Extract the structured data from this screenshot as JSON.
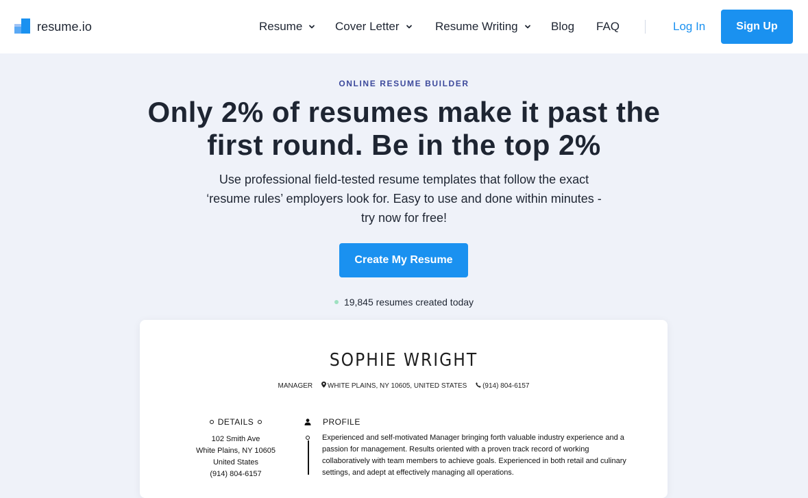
{
  "brand": {
    "name": "resume.io",
    "logo_icon": "resume-io-logo"
  },
  "nav": {
    "items": [
      {
        "label": "Resume",
        "has_dropdown": true
      },
      {
        "label": "Cover Letter",
        "has_dropdown": true
      },
      {
        "label": "Resume Writing",
        "has_dropdown": true
      },
      {
        "label": "Blog",
        "has_dropdown": false
      },
      {
        "label": "FAQ",
        "has_dropdown": false
      }
    ],
    "login_label": "Log In",
    "signup_label": "Sign Up"
  },
  "hero": {
    "eyebrow": "ONLINE RESUME BUILDER",
    "headline": "Only 2% of resumes make it past the first round. Be in the top 2%",
    "subtitle": "Use professional field-tested resume templates that follow the exact ‘resume rules’ employers look for. Easy to use and done within minutes - try now for free!",
    "cta_label": "Create My Resume",
    "counter": "19,845 resumes created today"
  },
  "resume_preview": {
    "name": "SOPHIE WRIGHT",
    "job_title": "MANAGER",
    "location": "WHITE PLAINS, NY 10605, UNITED STATES",
    "phone": "(914) 804-6157",
    "details_heading": "DETAILS",
    "details_lines": [
      "102 Smith Ave",
      "White Plains, NY 10605",
      "United States",
      "(914) 804-6157"
    ],
    "profile_heading": "PROFILE",
    "profile_text": "Experienced and self-motivated Manager bringing forth valuable industry experience and a passion for management. Results oriented with a proven track record of working collaboratively with team members to achieve goals. Experienced in both retail and culinary settings, and adept at effectively managing all operations."
  },
  "colors": {
    "accent": "#1a91f0",
    "page_background": "#eff2f9",
    "eyebrow": "#3d4a9c",
    "text": "#1e2532",
    "status_dot": "#9ee0c0"
  }
}
